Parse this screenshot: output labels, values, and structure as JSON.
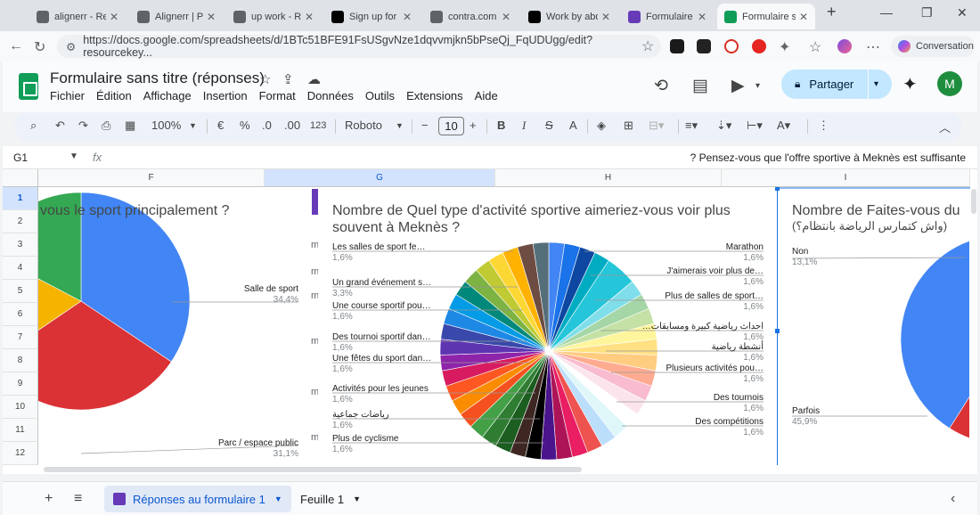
{
  "browser": {
    "tabs": [
      {
        "label": "alignerr - Rec",
        "favicon": "search-icon",
        "color": "#5f6368"
      },
      {
        "label": "Alignerr | Pow",
        "favicon": "triangle-icon",
        "color": "#5f6368"
      },
      {
        "label": "up work - Rec",
        "favicon": "search-icon",
        "color": "#5f6368"
      },
      {
        "label": "Sign up for U",
        "favicon": "upwork-icon",
        "color": "#000000"
      },
      {
        "label": "contra.com - ",
        "favicon": "search-icon",
        "color": "#5f6368"
      },
      {
        "label": "Work by abde",
        "favicon": "contra-icon",
        "color": "#000000"
      },
      {
        "label": "Formulaire sa",
        "favicon": "forms-icon",
        "color": "#673ab7"
      },
      {
        "label": "Formulaire sa",
        "favicon": "sheets-icon",
        "color": "#0f9d58",
        "active": true
      }
    ],
    "url": "https://docs.google.com/spreadsheets/d/1BTc51BFE91FsUSgvNze1dqvvmjkn5bPseQj_FqUDUgg/edit?resourcekey...",
    "conversation_label": "Conversation"
  },
  "sheets": {
    "title": "Formulaire sans titre (réponses)",
    "menu": [
      "Fichier",
      "Édition",
      "Affichage",
      "Insertion",
      "Format",
      "Données",
      "Outils",
      "Extensions",
      "Aide"
    ],
    "share_label": "Partager",
    "avatar_letter": "M",
    "toolbar": {
      "zoom": "100%",
      "currency": "€",
      "percent": "%",
      "dec_less": ".0",
      "dec_more": ".00",
      "number_format": "123",
      "font": "Roboto",
      "font_size": "10",
      "bold": "B",
      "italic": "I",
      "strike": "S",
      "text_color": "A"
    },
    "name_box": "G1",
    "fx": "fx",
    "formula": "? Pensez-vous que l'offre sportive à Meknès est suffisante",
    "columns": [
      "F",
      "G",
      "H",
      "I"
    ],
    "selected_column": "G",
    "rows": [
      "1",
      "2",
      "3",
      "4",
      "5",
      "6",
      "7",
      "8",
      "9",
      "10",
      "11",
      "12"
    ],
    "selected_row": "1",
    "cell_peek": "m",
    "sheet_tabs": [
      {
        "label": "Réponses au formulaire 1",
        "active": true
      },
      {
        "label": "Feuille 1",
        "active": false
      }
    ]
  },
  "chart_data": [
    {
      "type": "pie",
      "title": "vous le sport principalement ?",
      "slices": [
        {
          "label": "Salle de sport",
          "value": 34.4,
          "color": "#4285f4"
        },
        {
          "label": "Parc / espace public",
          "value": 31.1,
          "color": "#db3236"
        },
        {
          "label": "",
          "value": 17.2,
          "color": "#f4b400"
        },
        {
          "label": "",
          "value": 17.3,
          "color": "#34a853"
        }
      ],
      "labels_shown": [
        {
          "label": "Salle de sport",
          "pct": "34,4%"
        },
        {
          "label": "Parc / espace public",
          "pct": "31,1%"
        }
      ]
    },
    {
      "type": "pie",
      "title": "Nombre de Quel type d'activité sportive aimeriez-vous voir plus souvent à Meknès ?",
      "slices_count": 42,
      "left_labels": [
        {
          "label": "Les salles de sport fe…",
          "pct": "1,6%"
        },
        {
          "label": "Un grand événement s…",
          "pct": "3,3%"
        },
        {
          "label": "Une course sportif pou…",
          "pct": "1,6%"
        },
        {
          "label": "Des tournoi sportif dan…",
          "pct": "1,6%"
        },
        {
          "label": "Une fêtes du sport dan…",
          "pct": "1,6%"
        },
        {
          "label": "Activités pour les jeunes",
          "pct": "1,6%"
        },
        {
          "label": "رياضات جماعية",
          "pct": "1,6%"
        },
        {
          "label": "Plus de cyclisme",
          "pct": "1,6%"
        }
      ],
      "right_labels": [
        {
          "label": "Marathon",
          "pct": "1,6%"
        },
        {
          "label": "J'aimerais voir plus de…",
          "pct": "1,6%"
        },
        {
          "label": "Plus de salles de sport…",
          "pct": "1,6%"
        },
        {
          "label": "…احداث رياضية كبيرة ومسابقات",
          "pct": "1,6%"
        },
        {
          "label": "أنشطة رياضية",
          "pct": "1,6%"
        },
        {
          "label": "Plusieurs activités pou…",
          "pct": "1,6%"
        },
        {
          "label": "Des tournois",
          "pct": "1,6%"
        },
        {
          "label": "Des compétitions",
          "pct": "1,6%"
        }
      ],
      "colors": [
        "#4285f4",
        "#1a73e8",
        "#0d47a1",
        "#00acc1",
        "#26c6da",
        "#80deea",
        "#a5d6a7",
        "#c5e1a5",
        "#fff59d",
        "#ffe082",
        "#ffcc80",
        "#ffab91",
        "#f8bbd0",
        "#fce4ec",
        "#ffffff",
        "#e0f7fa",
        "#bbdefb",
        "#ef5350",
        "#e91e63",
        "#ad1457",
        "#4a148c",
        "#000000",
        "#3e2723",
        "#1b5e20",
        "#2e7d32",
        "#43a047",
        "#f4511e",
        "#fb8c00",
        "#ff5722",
        "#d81b60",
        "#8e24aa",
        "#5e35b1",
        "#3949ab",
        "#1e88e5",
        "#039be5",
        "#00897b",
        "#7cb342",
        "#c0ca33",
        "#fdd835",
        "#ffb300",
        "#6d4c41",
        "#546e7a"
      ]
    },
    {
      "type": "pie",
      "title": "Nombre de Faites-vous du",
      "subtitle": "(واش كتمارس الرياضة بانتظام؟)",
      "slices": [
        {
          "label": "Non",
          "value": 13.1,
          "color": "#f4b400"
        },
        {
          "label": "Parfois",
          "value": 45.9,
          "color": "#db3236"
        },
        {
          "label": "",
          "value": 41.0,
          "color": "#4285f4"
        }
      ],
      "labels_shown": [
        {
          "label": "Non",
          "pct": "13,1%"
        },
        {
          "label": "Parfois",
          "pct": "45,9%"
        }
      ]
    }
  ]
}
